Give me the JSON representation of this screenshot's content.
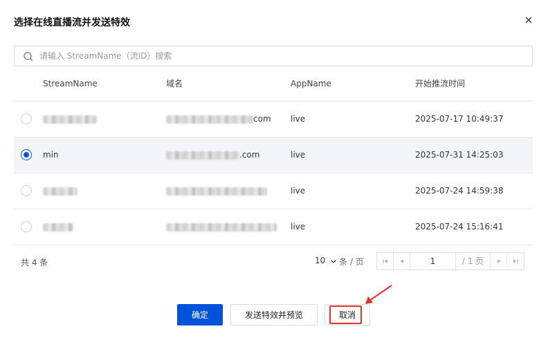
{
  "dialog": {
    "title": "选择在线直播流并发送特效",
    "close_icon": "close-icon"
  },
  "search": {
    "placeholder": "请输入 StreamName（流ID）搜索",
    "value": ""
  },
  "table": {
    "columns": [
      "StreamName",
      "域名",
      "AppName",
      "开始推流时间"
    ],
    "rows": [
      {
        "selected": false,
        "stream_name": "",
        "domain_suffix": "com",
        "app_name": "live",
        "start_time": "2025-07-17 10:49:37"
      },
      {
        "selected": true,
        "stream_name": "min",
        "domain_suffix": ".com",
        "app_name": "live",
        "start_time": "2025-07-31 14:25:03"
      },
      {
        "selected": false,
        "stream_name": "",
        "domain_suffix": "",
        "app_name": "live",
        "start_time": "2025-07-24 14:59:38"
      },
      {
        "selected": false,
        "stream_name": "",
        "domain_suffix": "",
        "app_name": "live",
        "start_time": "2025-07-24 15:16:41"
      }
    ]
  },
  "pagination": {
    "total_label": "共 4 条",
    "page_size": "10",
    "per_page_label": "条 / 页",
    "current_page": "1",
    "total_pages_label": "/ 1 页"
  },
  "buttons": {
    "confirm": "确定",
    "send_preview": "发送特效并预览",
    "cancel": "取消"
  },
  "colors": {
    "primary": "#0052d9",
    "highlight": "#e3312a"
  }
}
